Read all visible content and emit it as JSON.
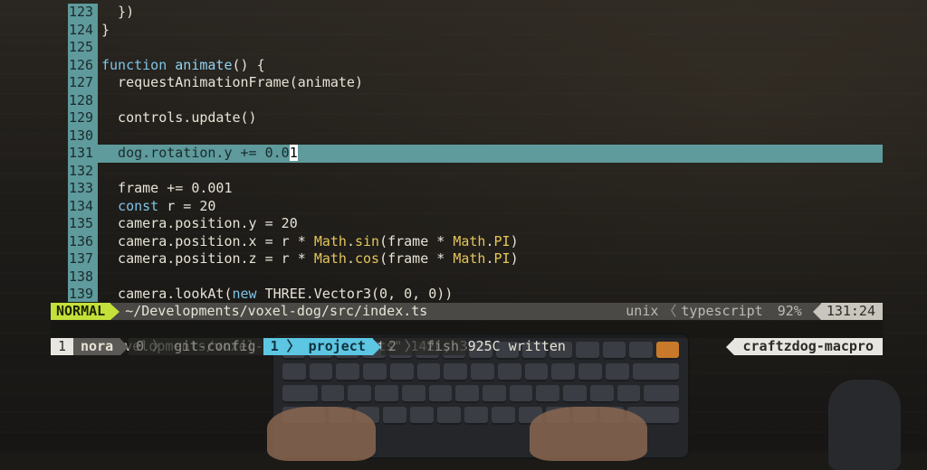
{
  "editor": {
    "lines": [
      {
        "num": "123",
        "segments": [
          {
            "t": "  })",
            "c": ""
          }
        ]
      },
      {
        "num": "124",
        "segments": [
          {
            "t": "}",
            "c": ""
          }
        ]
      },
      {
        "num": "125",
        "segments": []
      },
      {
        "num": "126",
        "segments": [
          {
            "t": "function",
            "c": "kw"
          },
          {
            "t": " ",
            "c": ""
          },
          {
            "t": "animate",
            "c": "fn"
          },
          {
            "t": "() {",
            "c": ""
          }
        ]
      },
      {
        "num": "127",
        "segments": [
          {
            "t": "  requestAnimationFrame(animate)",
            "c": ""
          }
        ]
      },
      {
        "num": "128",
        "segments": []
      },
      {
        "num": "129",
        "segments": [
          {
            "t": "  controls.update()",
            "c": ""
          }
        ]
      },
      {
        "num": "130",
        "segments": []
      },
      {
        "num": "131",
        "segments": [
          {
            "t": "  dog.rotation.y += 0.0",
            "c": ""
          },
          {
            "t": "1",
            "c": "cursor"
          }
        ],
        "current": true
      },
      {
        "num": "132",
        "segments": []
      },
      {
        "num": "133",
        "segments": [
          {
            "t": "  frame += 0.001",
            "c": ""
          }
        ]
      },
      {
        "num": "134",
        "segments": [
          {
            "t": "  ",
            "c": ""
          },
          {
            "t": "const",
            "c": "kw"
          },
          {
            "t": " r = 20",
            "c": ""
          }
        ]
      },
      {
        "num": "135",
        "segments": [
          {
            "t": "  camera.position.y = 20",
            "c": ""
          }
        ]
      },
      {
        "num": "136",
        "segments": [
          {
            "t": "  camera.position.x = r * ",
            "c": ""
          },
          {
            "t": "Math",
            "c": "yl"
          },
          {
            "t": ".",
            "c": ""
          },
          {
            "t": "sin",
            "c": "yl"
          },
          {
            "t": "(frame * ",
            "c": ""
          },
          {
            "t": "Math",
            "c": "yl"
          },
          {
            "t": ".",
            "c": ""
          },
          {
            "t": "PI",
            "c": "yl"
          },
          {
            "t": ")",
            "c": ""
          }
        ]
      },
      {
        "num": "137",
        "segments": [
          {
            "t": "  camera.position.z = r * ",
            "c": ""
          },
          {
            "t": "Math",
            "c": "yl"
          },
          {
            "t": ".",
            "c": ""
          },
          {
            "t": "cos",
            "c": "yl"
          },
          {
            "t": "(frame * ",
            "c": ""
          },
          {
            "t": "Math",
            "c": "yl"
          },
          {
            "t": ".",
            "c": ""
          },
          {
            "t": "PI",
            "c": "yl"
          },
          {
            "t": ")",
            "c": ""
          }
        ]
      },
      {
        "num": "138",
        "segments": []
      },
      {
        "num": "139",
        "segments": [
          {
            "t": "  camera.lookAt(",
            "c": ""
          },
          {
            "t": "new",
            "c": "kw"
          },
          {
            "t": " THREE.Vector3(0, 0, 0))",
            "c": ""
          }
        ]
      }
    ]
  },
  "statusline": {
    "mode": "NORMAL",
    "filepath": "~/Developments/voxel-dog/src/index.ts",
    "fileformat": "unix",
    "separator": "〈",
    "filetype": "typescript",
    "percent": "92%",
    "position": "131:24"
  },
  "cmdline": {
    "message": "\"~/Developments/voxel-dog/src/index.ts\" 142L, 3925C written"
  },
  "tmux": {
    "session_index": "1",
    "session_name": "nora",
    "windows": [
      {
        "index": "0",
        "name": "git-config",
        "active": false
      },
      {
        "index": "1",
        "name": "project",
        "active": true
      },
      {
        "index": "2",
        "name": "fish",
        "active": false
      }
    ],
    "window_sep": "〉",
    "hostname": "craftzdog-macpro"
  },
  "colors": {
    "gutter": "#5f9a9c",
    "mode_bg": "#c3e13a",
    "active_window": "#5cc6e3"
  }
}
